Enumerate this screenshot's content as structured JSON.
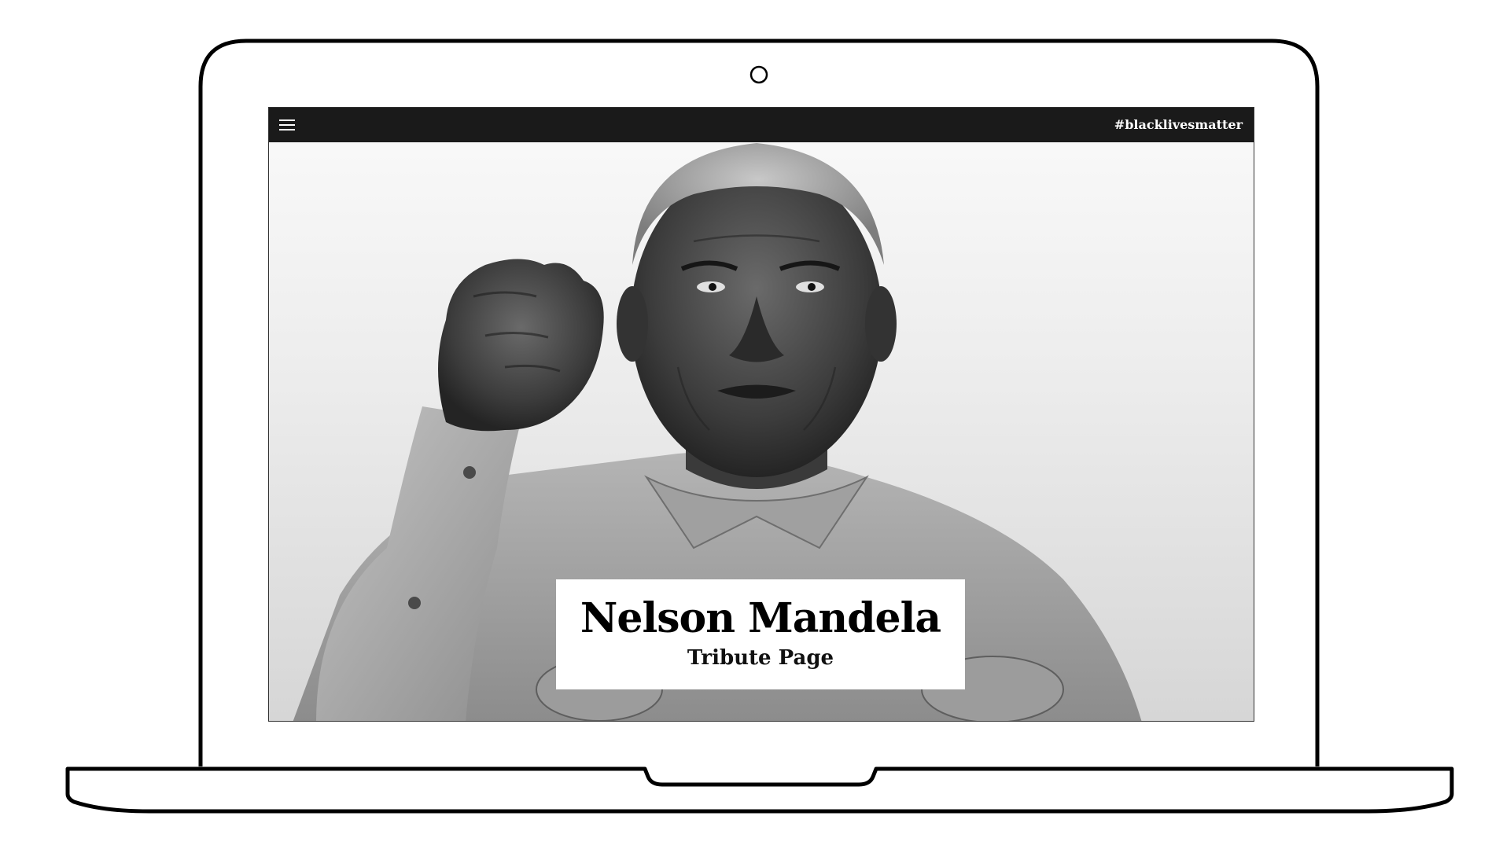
{
  "navbar": {
    "menu_icon": "hamburger-menu-icon",
    "hashtag": "#blacklivesmatter"
  },
  "hero": {
    "title": "Nelson Mandela",
    "subtitle": "Tribute Page"
  },
  "colors": {
    "navbar_bg": "#1a1a1a",
    "navbar_text": "#ffffff",
    "title_box_bg": "#ffffff",
    "title_text": "#000000"
  }
}
